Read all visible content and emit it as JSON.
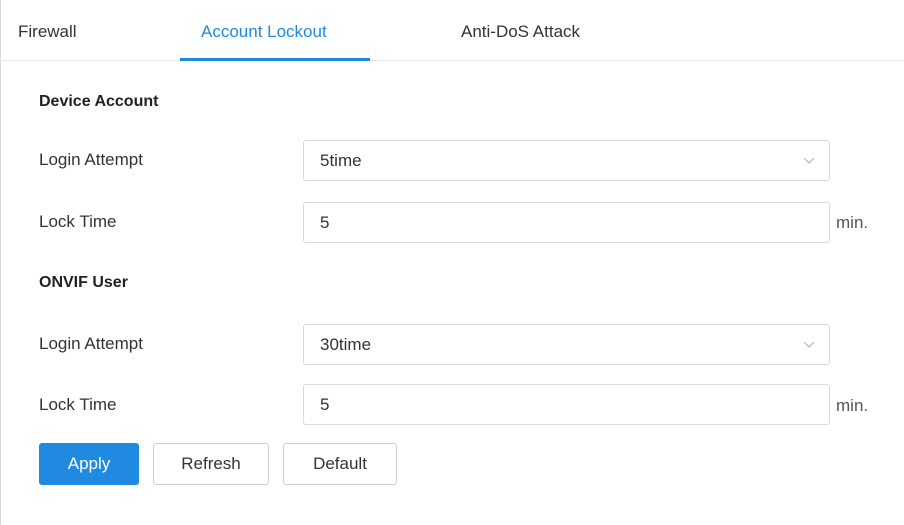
{
  "tabs": [
    {
      "label": "Firewall",
      "active": false
    },
    {
      "label": "Account Lockout",
      "active": true
    },
    {
      "label": "Anti-DoS Attack",
      "active": false
    }
  ],
  "device_account": {
    "title": "Device Account",
    "login_attempt": {
      "label": "Login Attempt",
      "value": "5time"
    },
    "lock_time": {
      "label": "Lock Time",
      "value": "5",
      "unit": "min."
    }
  },
  "onvif_user": {
    "title": "ONVIF User",
    "login_attempt": {
      "label": "Login Attempt",
      "value": "30time"
    },
    "lock_time": {
      "label": "Lock Time",
      "value": "5",
      "unit": "min."
    }
  },
  "buttons": {
    "apply": "Apply",
    "refresh": "Refresh",
    "default": "Default"
  },
  "colors": {
    "accent": "#1f8ae0",
    "border": "#d9d9d9",
    "text": "#333333"
  },
  "icons": {
    "dropdown": "chevron-down-icon"
  }
}
